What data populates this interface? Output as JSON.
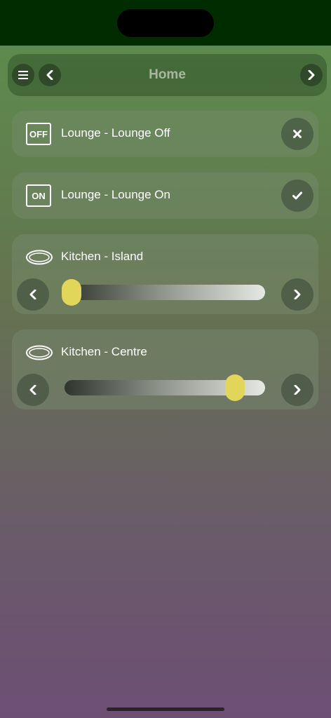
{
  "header": {
    "title": "Home"
  },
  "scenes": [
    {
      "label": "Lounge - Lounge Off",
      "badge": "OFF",
      "action": "close-icon"
    },
    {
      "label": "Lounge - Lounge On",
      "badge": "ON",
      "action": "checkmark-icon"
    }
  ],
  "lights": [
    {
      "label": "Kitchen - Island",
      "level_fraction": 0.0
    },
    {
      "label": "Kitchen - Centre",
      "level_fraction": 0.93
    }
  ],
  "colors": {
    "accent": "#e2d65a",
    "status_bar": "#002c00"
  }
}
